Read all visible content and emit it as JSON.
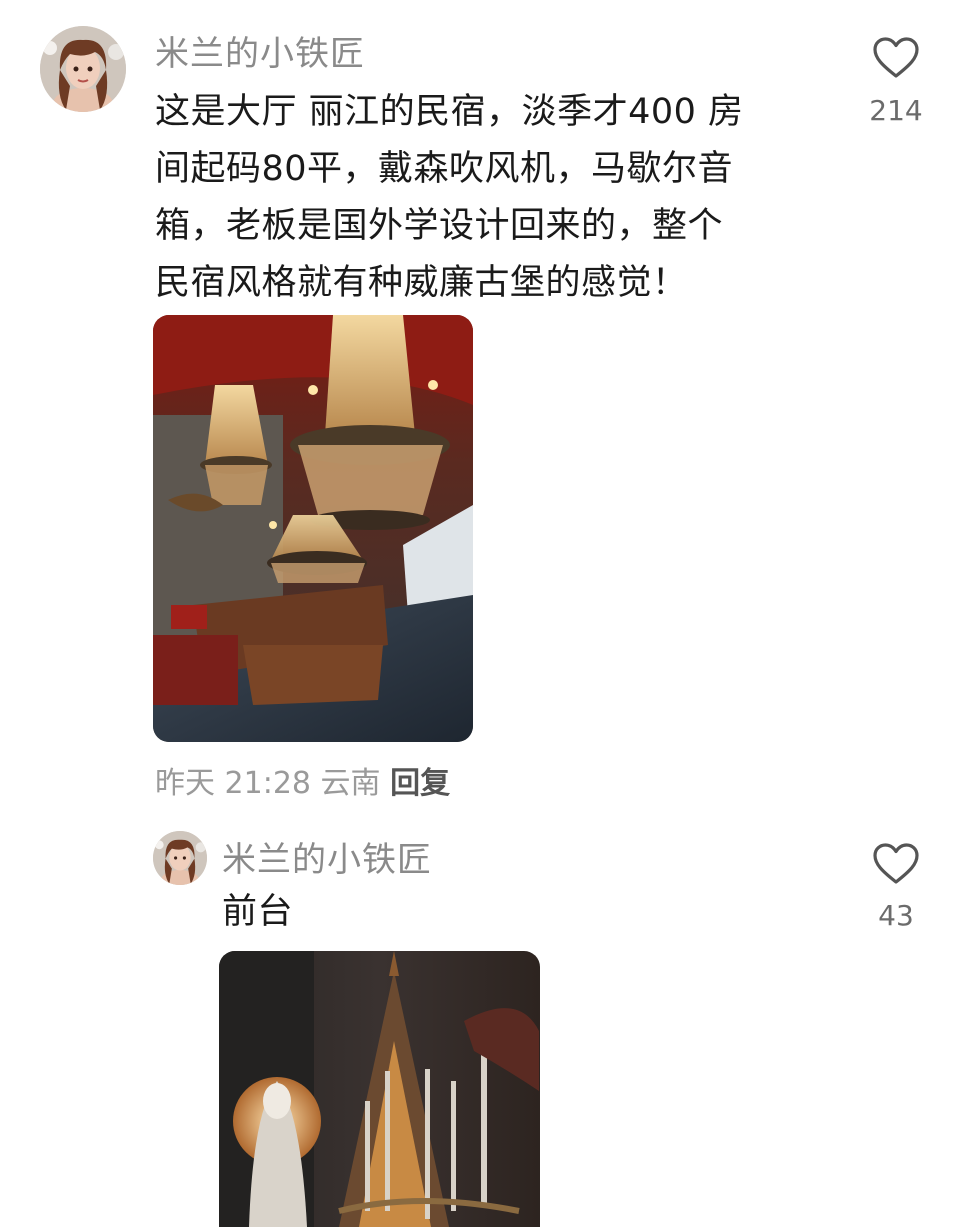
{
  "comments": [
    {
      "username": "米兰的小铁匠",
      "text_lines": [
        "这是大厅 丽江的民宿，淡季才400 房",
        "间起码80平，戴森吹风机，马歇尔音",
        "箱，老板是国外学设计回来的，整个",
        "民宿风格就有种威廉古堡的感觉！"
      ],
      "time": "昨天 21:28",
      "location": "云南",
      "reply_label": "回复",
      "like_count": "214",
      "image": "lobby-chandelier-photo"
    }
  ],
  "replies": [
    {
      "username": "米兰的小铁匠",
      "text": "前台",
      "like_count": "43",
      "image": "front-desk-candles-photo"
    }
  ],
  "icons": {
    "like": "heart-outline-icon"
  },
  "colors": {
    "username": "#8a8a8a",
    "text": "#1a1a1a",
    "meta": "#9a9a9a",
    "icon": "#555555"
  }
}
